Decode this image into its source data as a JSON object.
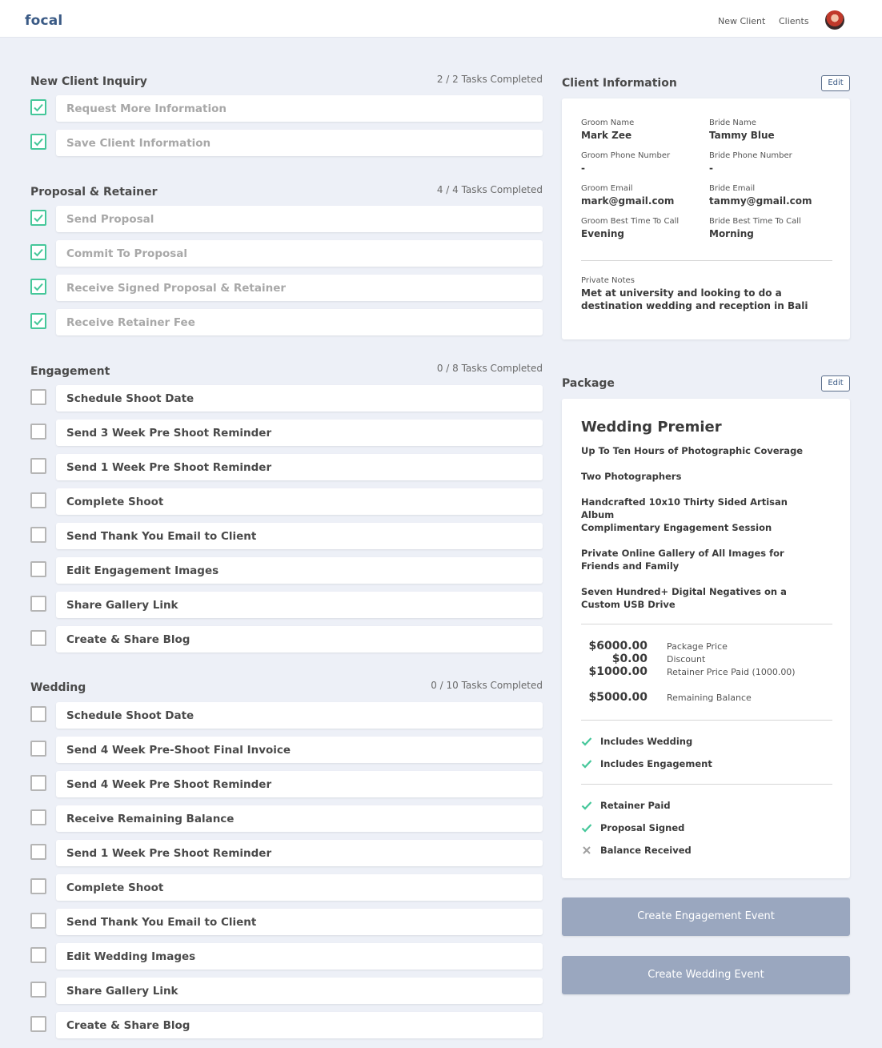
{
  "app": {
    "logo": "focal"
  },
  "nav": {
    "new_client": "New Client",
    "clients": "Clients"
  },
  "sections": [
    {
      "title": "New Client Inquiry",
      "count": "2 / 2 Tasks Completed",
      "tasks": [
        {
          "label": "Request More Information",
          "done": true
        },
        {
          "label": "Save Client Information",
          "done": true
        }
      ]
    },
    {
      "title": "Proposal & Retainer",
      "count": "4 / 4 Tasks Completed",
      "tasks": [
        {
          "label": "Send Proposal",
          "done": true
        },
        {
          "label": "Commit To Proposal",
          "done": true
        },
        {
          "label": "Receive Signed Proposal & Retainer",
          "done": true
        },
        {
          "label": "Receive Retainer Fee",
          "done": true
        }
      ]
    },
    {
      "title": "Engagement",
      "count": "0 / 8 Tasks Completed",
      "tasks": [
        {
          "label": "Schedule Shoot Date",
          "done": false
        },
        {
          "label": "Send 3 Week Pre Shoot Reminder",
          "done": false
        },
        {
          "label": "Send 1 Week Pre Shoot Reminder",
          "done": false
        },
        {
          "label": "Complete Shoot",
          "done": false
        },
        {
          "label": "Send Thank You Email to Client",
          "done": false
        },
        {
          "label": "Edit Engagement Images",
          "done": false
        },
        {
          "label": "Share Gallery Link",
          "done": false
        },
        {
          "label": "Create & Share Blog",
          "done": false
        }
      ]
    },
    {
      "title": "Wedding",
      "count": "0 / 10 Tasks Completed",
      "tasks": [
        {
          "label": "Schedule Shoot Date",
          "done": false
        },
        {
          "label": "Send 4 Week Pre-Shoot Final Invoice",
          "done": false
        },
        {
          "label": "Send 4 Week Pre Shoot Reminder",
          "done": false
        },
        {
          "label": "Receive Remaining Balance",
          "done": false
        },
        {
          "label": "Send 1 Week Pre Shoot Reminder",
          "done": false
        },
        {
          "label": "Complete Shoot",
          "done": false
        },
        {
          "label": "Send Thank You Email to Client",
          "done": false
        },
        {
          "label": "Edit Wedding Images",
          "done": false
        },
        {
          "label": "Share Gallery Link",
          "done": false
        },
        {
          "label": "Create & Share Blog",
          "done": false
        }
      ]
    }
  ],
  "client_info": {
    "title": "Client Information",
    "edit_label": "Edit",
    "groom_name_label": "Groom Name",
    "groom_name": "Mark Zee",
    "bride_name_label": "Bride Name",
    "bride_name": "Tammy Blue",
    "groom_phone_label": "Groom Phone Number",
    "groom_phone": "-",
    "bride_phone_label": "Bride Phone Number",
    "bride_phone": "-",
    "groom_email_label": "Groom Email",
    "groom_email": "mark@gmail.com",
    "bride_email_label": "Bride Email",
    "bride_email": "tammy@gmail.com",
    "groom_time_label": "Groom Best Time To Call",
    "groom_time": "Evening",
    "bride_time_label": "Bride Best Time To Call",
    "bride_time": "Morning",
    "notes_label": "Private Notes",
    "notes": "Met at university and looking to do a destination wedding and reception in Bali"
  },
  "package": {
    "title": "Package",
    "edit_label": "Edit",
    "name": "Wedding Premier",
    "features": [
      "Up To Ten Hours of Photographic Coverage",
      "Two Photographers",
      "Handcrafted 10x10 Thirty Sided Artisan Album",
      "Complimentary Engagement Session",
      "Private Online Gallery of All Images for Friends and Family",
      "Seven Hundred+ Digital Negatives on a Custom USB Drive"
    ],
    "pricing": [
      {
        "amount": "$6000.00",
        "label": "Package Price"
      },
      {
        "amount": "$0.00",
        "label": "Discount"
      },
      {
        "amount": "$1000.00",
        "label": "Retainer Price Paid (1000.00)"
      },
      {
        "amount": "$5000.00",
        "label": "Remaining Balance"
      }
    ],
    "includes": [
      {
        "label": "Includes Wedding",
        "ok": true
      },
      {
        "label": "Includes Engagement",
        "ok": true
      }
    ],
    "status": [
      {
        "label": "Retainer Paid",
        "ok": true
      },
      {
        "label": "Proposal Signed",
        "ok": true
      },
      {
        "label": "Balance Received",
        "ok": false
      }
    ]
  },
  "actions": {
    "create_engagement": "Create Engagement Event",
    "create_wedding": "Create Wedding Event"
  },
  "colors": {
    "brand": "#3a5a85",
    "check": "#45c79a",
    "button": "#9aa7bf",
    "background": "#edf0f7"
  }
}
